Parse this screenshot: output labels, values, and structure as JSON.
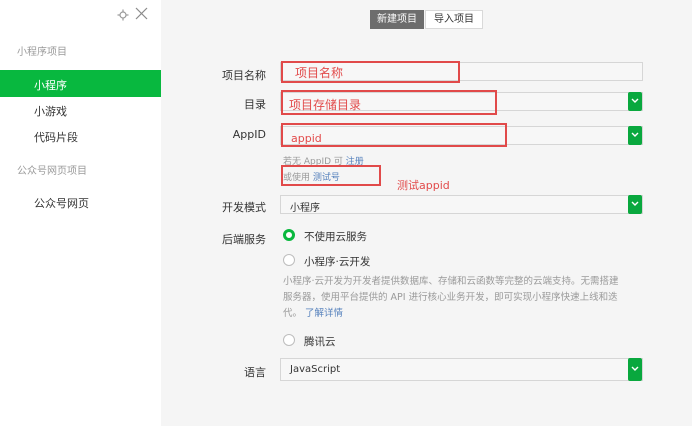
{
  "sidebar": {
    "group1": "小程序项目",
    "items1": [
      "小程序",
      "小游戏",
      "代码片段"
    ],
    "group2": "公众号网页项目",
    "items2": [
      "公众号网页"
    ]
  },
  "tabs": [
    "新建项目",
    "导入项目"
  ],
  "form": {
    "name_label": "项目名称",
    "name_placeholder": "项目名称",
    "dir_label": "目录",
    "dir_placeholder": "项目存储目录",
    "appid_label": "AppID",
    "appid_value": "appid",
    "hint1_prefix": "若无 AppID 可",
    "hint1_link": "注册",
    "hint2_prefix": "或使用",
    "hint2_link": "测试号",
    "test_annotation": "测试appid",
    "devmode_label": "开发模式",
    "devmode_value": "小程序",
    "backend_label": "后端服务",
    "backend_options": [
      "不使用云服务",
      "小程序·云开发",
      "腾讯云"
    ],
    "backend_desc_line1": "小程序·云开发为开发者提供数据库、存储和云函数等完整的云端支持。无需搭建",
    "backend_desc_line2": "服务器，使用平台提供的 API 进行核心业务开发，即可实现小程序快速上线和迭",
    "backend_desc_line3_prefix": "代。",
    "backend_desc_link": "了解详情",
    "lang_label": "语言",
    "lang_value": "JavaScript"
  },
  "colors": {
    "accent_green": "#09b83e",
    "annotation_red": "#e14a4a",
    "link_blue": "#5782bd"
  }
}
